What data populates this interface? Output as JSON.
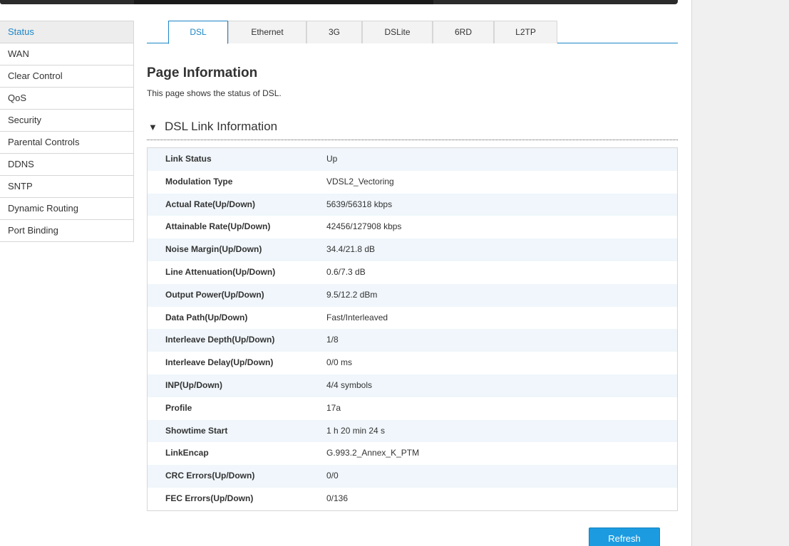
{
  "sidebar": {
    "items": [
      {
        "label": "Status",
        "active": true
      },
      {
        "label": "WAN"
      },
      {
        "label": "Clear Control"
      },
      {
        "label": "QoS"
      },
      {
        "label": "Security"
      },
      {
        "label": "Parental Controls"
      },
      {
        "label": "DDNS"
      },
      {
        "label": "SNTP"
      },
      {
        "label": "Dynamic Routing"
      },
      {
        "label": "Port Binding"
      }
    ]
  },
  "tabs": [
    {
      "label": "DSL",
      "active": true
    },
    {
      "label": "Ethernet"
    },
    {
      "label": "3G"
    },
    {
      "label": "DSLite"
    },
    {
      "label": "6RD"
    },
    {
      "label": "L2TP"
    }
  ],
  "page": {
    "title": "Page Information",
    "description": "This page shows the status of DSL."
  },
  "section": {
    "arrow": "▼",
    "title": "DSL Link Information"
  },
  "dsl_info": [
    {
      "label": "Link Status",
      "value": "Up"
    },
    {
      "label": "Modulation Type",
      "value": "VDSL2_Vectoring"
    },
    {
      "label": "Actual Rate(Up/Down)",
      "value": "5639/56318 kbps"
    },
    {
      "label": "Attainable Rate(Up/Down)",
      "value": "42456/127908 kbps"
    },
    {
      "label": "Noise Margin(Up/Down)",
      "value": "34.4/21.8 dB"
    },
    {
      "label": "Line Attenuation(Up/Down)",
      "value": "0.6/7.3 dB"
    },
    {
      "label": "Output Power(Up/Down)",
      "value": "9.5/12.2 dBm"
    },
    {
      "label": "Data Path(Up/Down)",
      "value": "Fast/Interleaved"
    },
    {
      "label": "Interleave Depth(Up/Down)",
      "value": "1/8"
    },
    {
      "label": "Interleave Delay(Up/Down)",
      "value": "0/0 ms"
    },
    {
      "label": "INP(Up/Down)",
      "value": "4/4 symbols"
    },
    {
      "label": "Profile",
      "value": "17a"
    },
    {
      "label": "Showtime Start",
      "value": "1 h 20 min 24 s"
    },
    {
      "label": "LinkEncap",
      "value": "G.993.2_Annex_K_PTM"
    },
    {
      "label": "CRC Errors(Up/Down)",
      "value": "0/0"
    },
    {
      "label": "FEC Errors(Up/Down)",
      "value": "0/136"
    }
  ],
  "actions": {
    "refresh_label": "Refresh"
  },
  "colors": {
    "accent": "#1c86c6",
    "button": "#1c9be0",
    "row_alt": "#f0f6fb"
  }
}
